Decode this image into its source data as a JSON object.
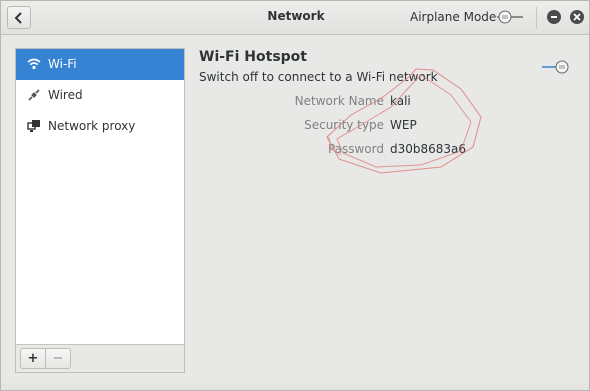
{
  "window": {
    "title": "Network",
    "airplane_mode_label": "Airplane Mode",
    "airplane_mode_on": false
  },
  "sidebar": {
    "items": [
      {
        "label": "Wi-Fi",
        "icon": "wifi-icon",
        "active": true
      },
      {
        "label": "Wired",
        "icon": "wired-icon",
        "active": false
      },
      {
        "label": "Network proxy",
        "icon": "network-proxy-icon",
        "active": false
      }
    ],
    "add_label": "+",
    "remove_label": "−"
  },
  "hotspot": {
    "title": "Wi-Fi Hotspot",
    "subtitle": "Switch off to connect to a Wi-Fi network",
    "enabled": true,
    "fields": [
      {
        "label": "Network Name",
        "value": "kali"
      },
      {
        "label": "Security type",
        "value": "WEP"
      },
      {
        "label": "Password",
        "value": "d30b8683a6"
      }
    ]
  },
  "colors": {
    "accent": "#3583d2",
    "annotation": "#e07a7a"
  }
}
